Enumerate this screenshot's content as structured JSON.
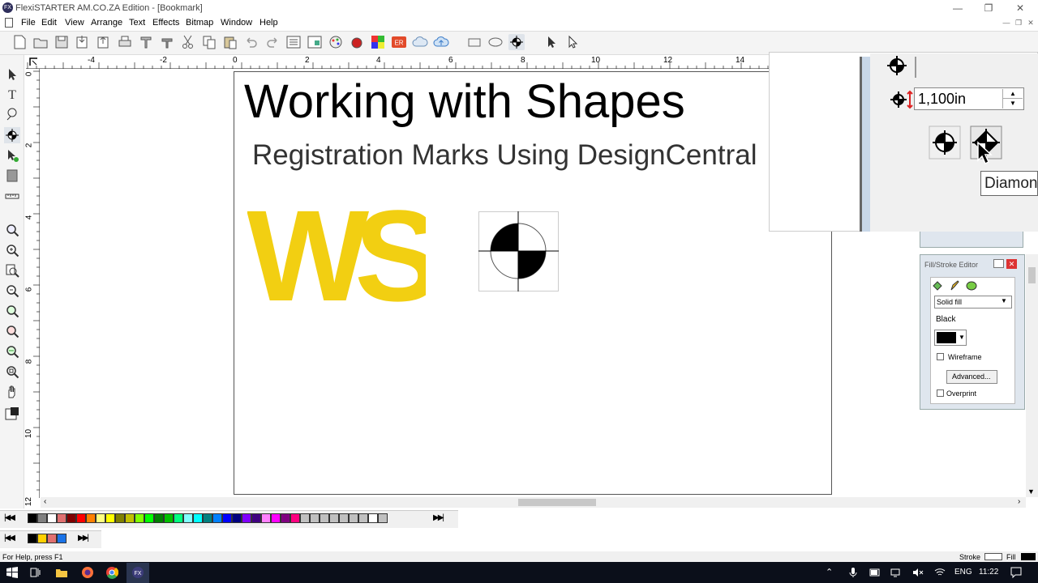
{
  "window": {
    "title": "FlexiSTARTER AM.CO.ZA Edition - [Bookmark]",
    "app_icon_text": "FX"
  },
  "menu": [
    "File",
    "Edit",
    "View",
    "Arrange",
    "Text",
    "Effects",
    "Bitmap",
    "Window",
    "Help"
  ],
  "ruler": {
    "top_ticks": [
      "-4",
      "-2",
      "0",
      "2",
      "4",
      "6",
      "8",
      "10",
      "12",
      "14"
    ],
    "left_ticks": [
      "0",
      "2",
      "4",
      "6",
      "8",
      "10",
      "12"
    ]
  },
  "document": {
    "heading": "Working with Shapes",
    "subheading": "Registration Marks Using DesignCentral",
    "logo_text": "WS",
    "logo_color": "#f2cf12"
  },
  "zoom_panel": {
    "size_value": "1,100in",
    "tooltip": "Diamond"
  },
  "fill_stroke_editor": {
    "title": "Fill/Stroke Editor",
    "fill_type": "Solid fill",
    "color_name": "Black",
    "wireframe_label": "Wireframe",
    "wireframe_checked": false,
    "advanced_label": "Advanced...",
    "overprint_label": "Overprint",
    "overprint_checked": false
  },
  "palette_main": [
    "#000000",
    "#808080",
    "#ffffff",
    "#e07070",
    "#800000",
    "#ff0000",
    "#ff8000",
    "#ffff80",
    "#ffff00",
    "#808000",
    "#c0c000",
    "#80ff00",
    "#00ff00",
    "#008000",
    "#00c000",
    "#00ff80",
    "#80ffff",
    "#00ffff",
    "#008080",
    "#0080ff",
    "#0000ff",
    "#000080",
    "#8000ff",
    "#400080",
    "#ff80ff",
    "#ff00ff",
    "#800080",
    "#ff0080",
    "#c0c0c0",
    "#c0c0c0",
    "#c0c0c0",
    "#c0c0c0",
    "#c0c0c0",
    "#c0c0c0",
    "#c0c0c0",
    "#ffffff",
    "#c0c0c0"
  ],
  "palette_secondary": [
    "#000000",
    "#ffd000",
    "#e07070",
    "#1a73e8"
  ],
  "status": {
    "help": "For Help, press F1",
    "stroke_label": "Stroke",
    "fill_label": "Fill"
  },
  "taskbar": {
    "lang": "ENG",
    "time": "11:22"
  }
}
